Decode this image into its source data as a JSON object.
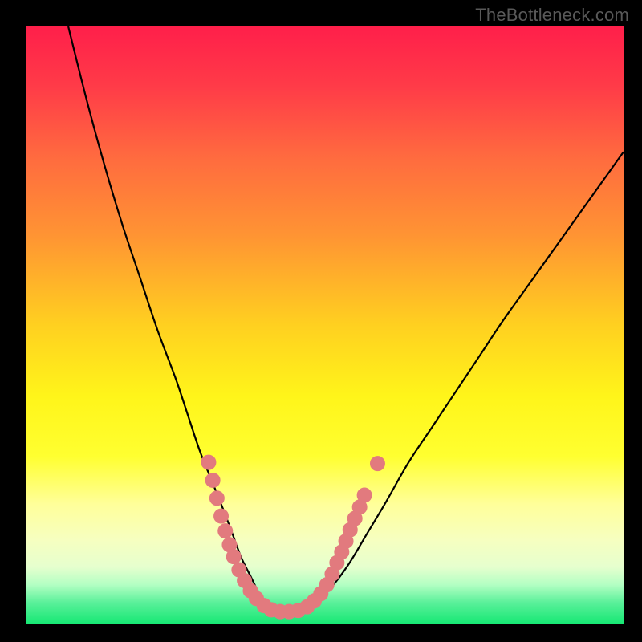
{
  "watermark": "TheBottleneck.com",
  "colors": {
    "frame": "#000000",
    "curve": "#000000",
    "marker_fill": "#e27a7e",
    "marker_stroke": "#e27a7e"
  },
  "gradient_stops": [
    {
      "offset": 0.0,
      "color": "#ff1f4a"
    },
    {
      "offset": 0.1,
      "color": "#ff3b48"
    },
    {
      "offset": 0.22,
      "color": "#ff6b3f"
    },
    {
      "offset": 0.35,
      "color": "#ff9433"
    },
    {
      "offset": 0.5,
      "color": "#ffd020"
    },
    {
      "offset": 0.62,
      "color": "#fff51a"
    },
    {
      "offset": 0.72,
      "color": "#ffff30"
    },
    {
      "offset": 0.8,
      "color": "#ffff9a"
    },
    {
      "offset": 0.86,
      "color": "#f6ffc0"
    },
    {
      "offset": 0.905,
      "color": "#e6ffce"
    },
    {
      "offset": 0.935,
      "color": "#b3ffc3"
    },
    {
      "offset": 0.965,
      "color": "#5af09a"
    },
    {
      "offset": 1.0,
      "color": "#17e874"
    }
  ],
  "chart_data": {
    "type": "line",
    "title": "",
    "xlabel": "",
    "ylabel": "",
    "xlim": [
      0,
      100
    ],
    "ylim": [
      0,
      100
    ],
    "legend": false,
    "grid": false,
    "series": [
      {
        "name": "bottleneck-curve",
        "x": [
          7,
          10,
          13,
          16,
          19,
          22,
          25,
          27,
          29,
          31,
          33,
          34.5,
          36,
          37.5,
          39,
          40.5,
          42.5,
          45,
          48,
          51,
          54,
          57,
          60,
          64,
          68,
          72,
          76,
          80,
          85,
          90,
          95,
          100
        ],
        "y": [
          100,
          88,
          77,
          67,
          58,
          49,
          41,
          35,
          29,
          24,
          19,
          15,
          11,
          8,
          5,
          3,
          2,
          2,
          3,
          6,
          10,
          15,
          20,
          27,
          33,
          39,
          45,
          51,
          58,
          65,
          72,
          79
        ]
      }
    ],
    "markers": [
      {
        "x": 30.5,
        "y": 27
      },
      {
        "x": 31.2,
        "y": 24
      },
      {
        "x": 31.9,
        "y": 21
      },
      {
        "x": 32.6,
        "y": 18
      },
      {
        "x": 33.3,
        "y": 15.5
      },
      {
        "x": 34.0,
        "y": 13.2
      },
      {
        "x": 34.7,
        "y": 11.2
      },
      {
        "x": 35.6,
        "y": 9.0
      },
      {
        "x": 36.5,
        "y": 7.2
      },
      {
        "x": 37.5,
        "y": 5.5
      },
      {
        "x": 38.5,
        "y": 4.2
      },
      {
        "x": 39.8,
        "y": 3.0
      },
      {
        "x": 41.0,
        "y": 2.3
      },
      {
        "x": 42.5,
        "y": 2.0
      },
      {
        "x": 44.0,
        "y": 2.0
      },
      {
        "x": 45.5,
        "y": 2.2
      },
      {
        "x": 47.0,
        "y": 2.8
      },
      {
        "x": 48.2,
        "y": 3.8
      },
      {
        "x": 49.3,
        "y": 5.0
      },
      {
        "x": 50.3,
        "y": 6.5
      },
      {
        "x": 51.2,
        "y": 8.3
      },
      {
        "x": 52.0,
        "y": 10.2
      },
      {
        "x": 52.8,
        "y": 12.0
      },
      {
        "x": 53.5,
        "y": 13.8
      },
      {
        "x": 54.2,
        "y": 15.7
      },
      {
        "x": 55.0,
        "y": 17.6
      },
      {
        "x": 55.8,
        "y": 19.5
      },
      {
        "x": 56.6,
        "y": 21.5
      },
      {
        "x": 58.8,
        "y": 26.8
      }
    ]
  }
}
